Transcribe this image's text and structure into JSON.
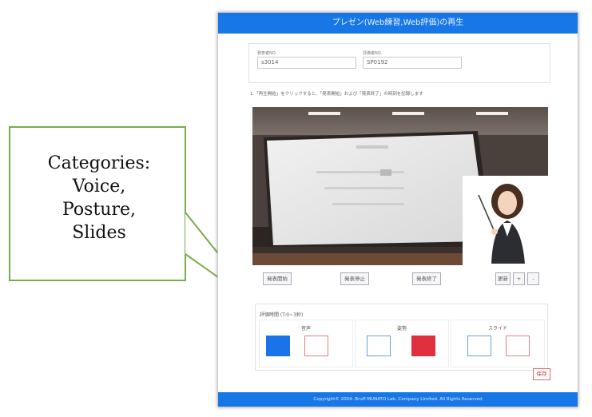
{
  "callout": {
    "lines": [
      "Categories:",
      "Voice,",
      "Posture,",
      "Slides"
    ]
  },
  "app": {
    "title": "プレゼン(Web練習,Web評価)の再生",
    "fields": [
      {
        "label": "発表者NO.",
        "value": "s3014"
      },
      {
        "label": "評価者NO.",
        "value": "SP0192"
      }
    ],
    "instruction": "1.「再生開始」をクリックすると、「発表開始」および「発表終了」の時刻を記録します",
    "controls": {
      "start_label": "発表開始",
      "stop_label": "発表停止",
      "end_label": "発表終了",
      "reset_label": "更新",
      "plus_label": "+",
      "minus_label": "-"
    },
    "evaluation": {
      "title": "評価時間 (T:0~3秒)",
      "categories": [
        {
          "label": "音声",
          "left_state": "filled",
          "right_state": "empty"
        },
        {
          "label": "姿勢",
          "left_state": "empty",
          "right_state": "filled"
        },
        {
          "label": "スライド",
          "left_state": "empty",
          "right_state": "empty"
        }
      ],
      "colors": {
        "blue": "#1a73e8",
        "red": "#e03040"
      }
    },
    "submit_label": "保存",
    "footer": "Copyright© 2004- Bruff·MUNATO Lab. Company Limited. All Rights Reserved"
  },
  "colors": {
    "header": "#1877e6",
    "callout_border": "#79ab49"
  }
}
